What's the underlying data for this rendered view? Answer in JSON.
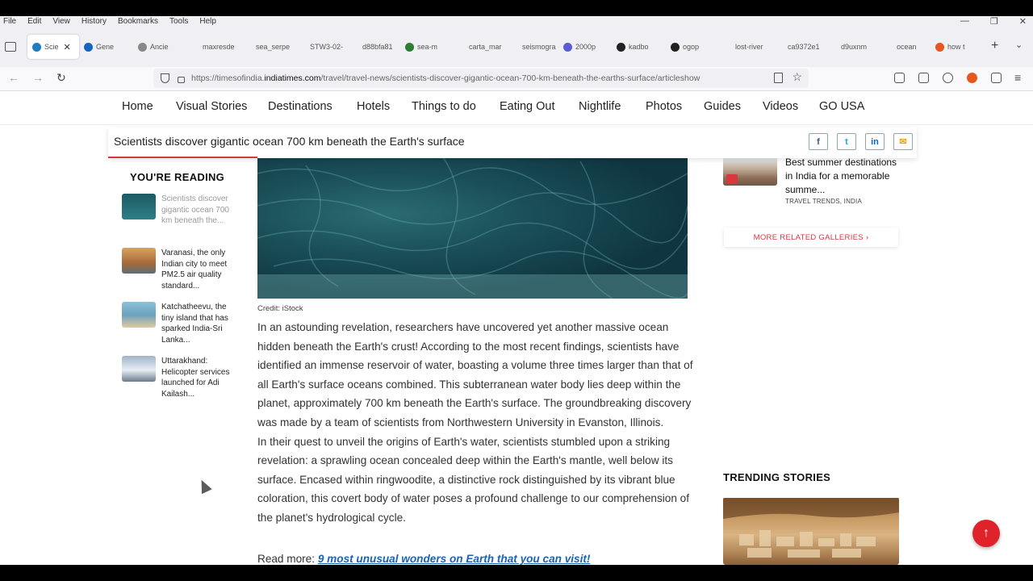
{
  "browser": {
    "menu": [
      "File",
      "Edit",
      "View",
      "History",
      "Bookmarks",
      "Tools",
      "Help"
    ],
    "tabs": [
      {
        "label": "Scie",
        "favicon_color": "#1e7bc4",
        "active": true
      },
      {
        "label": "Gene",
        "favicon_color": "#1565c0"
      },
      {
        "label": "Ancie",
        "favicon_color": "#888888"
      },
      {
        "label": "maxresde",
        "favicon_color": "#f0f0f4"
      },
      {
        "label": "sea_serpe",
        "favicon_color": "#f0f0f4"
      },
      {
        "label": "STW3-02-",
        "favicon_color": "#f0f0f4"
      },
      {
        "label": "d88bfa81",
        "favicon_color": "#f0f0f4"
      },
      {
        "label": "sea-m",
        "favicon_color": "#2e7d32"
      },
      {
        "label": "carta_mar",
        "favicon_color": "#f0f0f4"
      },
      {
        "label": "seismogra",
        "favicon_color": "#f0f0f4"
      },
      {
        "label": "2000p",
        "favicon_color": "#5b5bd6"
      },
      {
        "label": "kadbo",
        "favicon_color": "#222222"
      },
      {
        "label": "ogop",
        "favicon_color": "#222222"
      },
      {
        "label": "lost-river",
        "favicon_color": "#f0f0f4"
      },
      {
        "label": "ca9372e1",
        "favicon_color": "#f0f0f4"
      },
      {
        "label": "d9uxnm",
        "favicon_color": "#f0f0f4"
      },
      {
        "label": "ocean",
        "favicon_color": "#f0f0f4"
      },
      {
        "label": "how t",
        "favicon_color": "#e8561f"
      }
    ],
    "url_prefix": "https://timesofindia.",
    "url_domain": "indiatimes.com",
    "url_path": "/travel/travel-news/scientists-discover-gigantic-ocean-700-km-beneath-the-earths-surface/articleshow"
  },
  "site_nav": [
    "Home",
    "Visual Stories",
    "Destinations",
    "Hotels",
    "Things to do",
    "Eating Out",
    "Nightlife",
    "Photos",
    "Guides",
    "Videos",
    "GO USA"
  ],
  "sticky": {
    "headline": "Scientists discover gigantic ocean 700 km beneath the Earth's surface",
    "share": [
      {
        "label": "f",
        "color": "#3b5998",
        "icon": "facebook-icon"
      },
      {
        "label": "t",
        "color": "#1da1f2",
        "icon": "twitter-icon"
      },
      {
        "label": "in",
        "color": "#0a66c2",
        "icon": "linkedin-icon"
      },
      {
        "label": "✉",
        "color": "#f0a30a",
        "icon": "mail-icon"
      }
    ]
  },
  "youre_reading": {
    "heading": "YOU'RE READING",
    "items": [
      {
        "text": "Scientists discover gigantic ocean 700 km beneath the...",
        "current": true
      },
      {
        "text": "Varanasi, the only Indian city to meet PM2.5 air quality standard..."
      },
      {
        "text": "Katchatheevu, the tiny island that has sparked India-Sri Lanka..."
      },
      {
        "text": "Uttarakhand: Helicopter services launched for Adi Kailash..."
      }
    ]
  },
  "article": {
    "credit": "Credit: iStock",
    "paragraphs": [
      "In an astounding revelation, researchers have uncovered yet another massive ocean hidden beneath the Earth's crust! According to the most recent findings, scientists have identified an immense reservoir of water, boasting a volume three times larger than that of all Earth's surface oceans combined. This subterranean water body lies deep within the planet, approximately 700 km beneath the Earth's surface. The groundbreaking discovery was made by a team of scientists from Northwestern University in Evanston, Illinois.",
      "In their quest to unveil the origins of Earth's water, scientists stumbled upon a striking revelation: a sprawling ocean concealed deep within the Earth's mantle, well below its surface. Encased within ringwoodite, a distinctive rock distinguished by its vibrant blue coloration, this covert body of water poses a profound challenge to our comprehension of the planet's hydrological cycle."
    ],
    "read_more_label": "Read more: ",
    "read_more_link": "9 most unusual wonders on Earth that you can visit!"
  },
  "related": {
    "title": "Best summer destinations in India for a memorable summe...",
    "meta": "TRAVEL TRENDS, INDIA",
    "more_galleries": "MORE RELATED GALLERIES ›"
  },
  "trending": {
    "heading": "TRENDING STORIES"
  },
  "colors": {
    "accent": "#d9363e",
    "link": "#1a63b8",
    "scroll_top": "#e0222a"
  }
}
